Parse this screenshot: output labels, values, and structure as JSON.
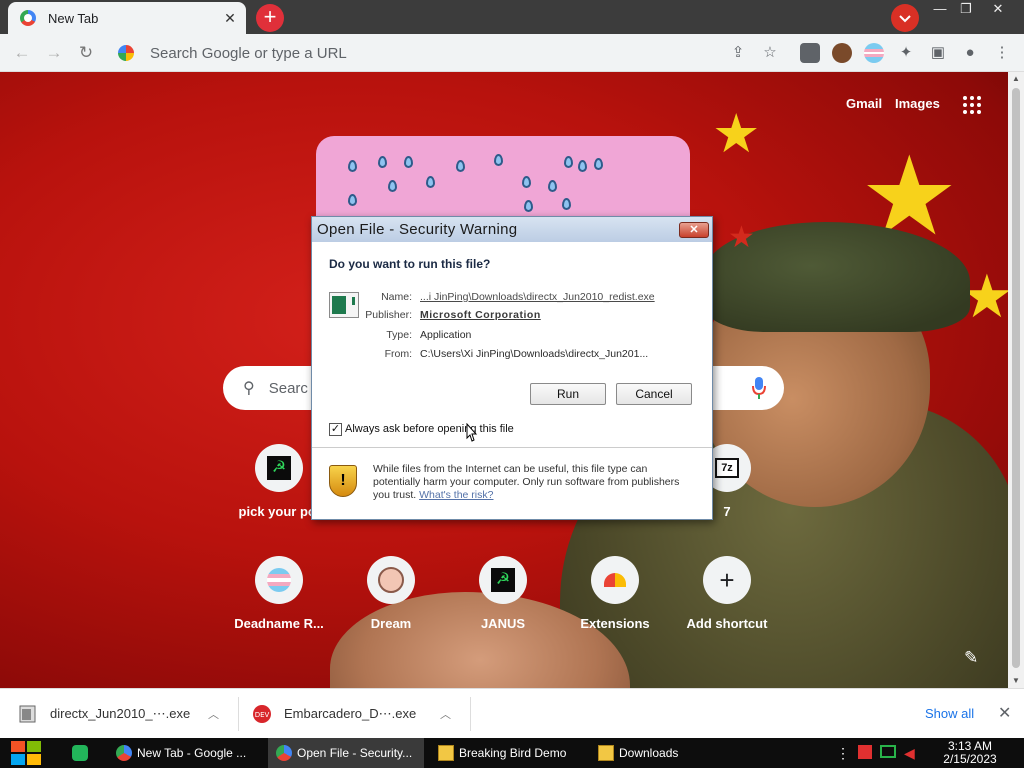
{
  "browser": {
    "tab_title": "New Tab",
    "tab_close": "✕",
    "new_tab": "+",
    "window_controls": [
      "—",
      "❐",
      "✕"
    ],
    "omnibox_placeholder": "Search Google or type a URL"
  },
  "ntp": {
    "gmail": "Gmail",
    "images": "Images",
    "search_placeholder": "Searc",
    "shortcuts_row1": [
      {
        "label": "pick your poi"
      },
      {
        "label": "7"
      }
    ],
    "shortcuts_row2": [
      {
        "label": "Deadname R..."
      },
      {
        "label": "Dream"
      },
      {
        "label": "JANUS"
      },
      {
        "label": "Extensions"
      },
      {
        "label": "Add shortcut"
      }
    ],
    "hammer_sickle": "☭",
    "sevenzip": "7z",
    "add_plus": "+"
  },
  "dialog": {
    "title": "Open File - Security Warning",
    "close": "✕",
    "question": "Do you want to run this file?",
    "fields": [
      {
        "key": "Name:",
        "value": "...i JinPing\\Downloads\\directx_Jun2010_redist.exe"
      },
      {
        "key": "Publisher:",
        "value": "Microsoft Corporation"
      },
      {
        "key": "Type:",
        "value": "Application"
      },
      {
        "key": "From:",
        "value": "C:\\Users\\Xi JinPing\\Downloads\\directx_Jun201..."
      }
    ],
    "run": "Run",
    "cancel": "Cancel",
    "checkbox_label": "Always ask before opening this file",
    "checkbox_checked": true,
    "warning_text": "While files from the Internet can be useful, this file type can potentially harm your computer. Only run software from publishers you trust.",
    "risk_link": "What's the risk?"
  },
  "downloads": {
    "items": [
      {
        "name": "directx_Jun2010_⋯.exe"
      },
      {
        "name": "Embarcadero_D⋯.exe"
      }
    ],
    "show_all": "Show all",
    "close": "✕"
  },
  "taskbar": {
    "items": [
      {
        "label": "New Tab - Google ..."
      },
      {
        "label": "Open File - Security..."
      },
      {
        "label": "Breaking Bird Demo"
      },
      {
        "label": "Downloads"
      }
    ],
    "time": "3:13 AM",
    "date": "2/15/2023"
  }
}
